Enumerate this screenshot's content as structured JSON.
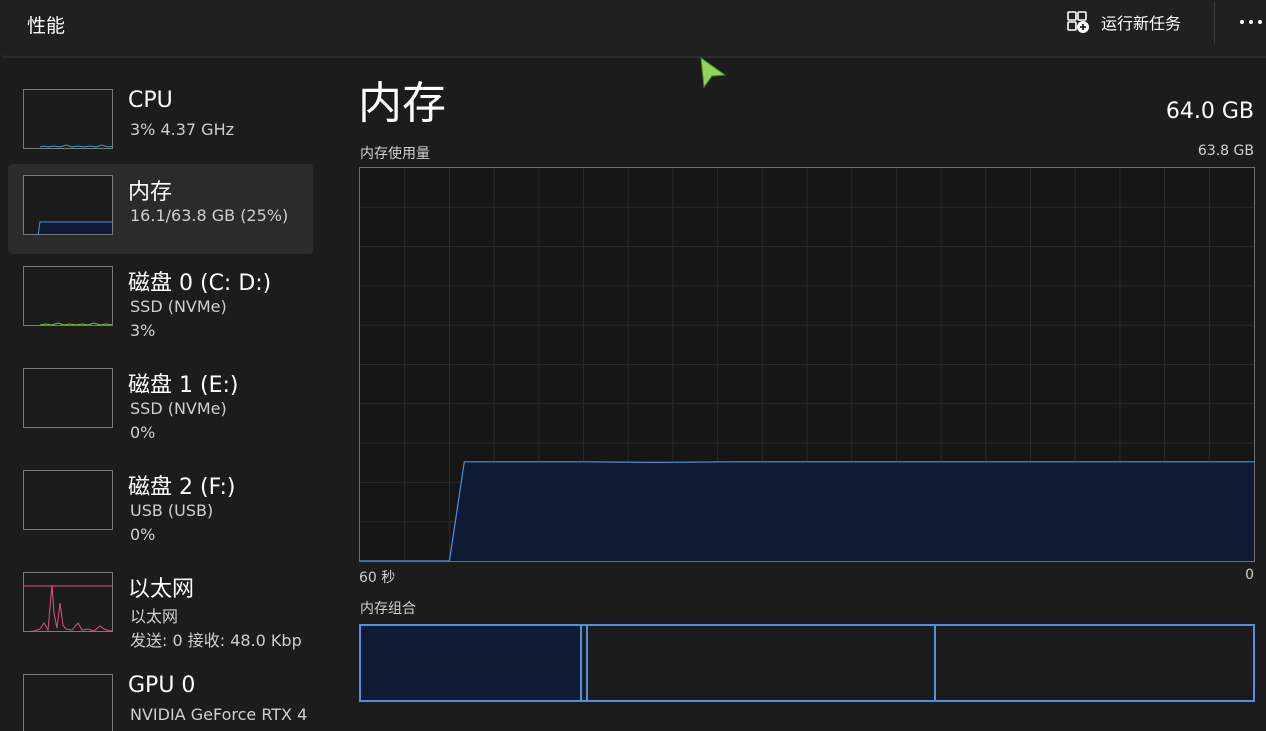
{
  "header": {
    "title": "性能",
    "run_task_label": "运行新任务",
    "more_icon": "more-icon",
    "run_task_icon": "run-task-icon"
  },
  "sidebar": {
    "items": [
      {
        "title": "CPU",
        "line1": "3%  4.37 GHz",
        "line2": "",
        "color": "#3a9bd1",
        "selected": false
      },
      {
        "title": "内存",
        "line1": "16.1/63.8 GB (25%)",
        "line2": "",
        "color": "#4f8fe6",
        "selected": true,
        "usage_fraction": 0.25
      },
      {
        "title": "磁盘 0 (C: D:)",
        "line1": "SSD (NVMe)",
        "line2": "3%",
        "color": "#7bbf3a",
        "selected": false
      },
      {
        "title": "磁盘 1 (E:)",
        "line1": "SSD (NVMe)",
        "line2": "0%",
        "color": "#7bbf3a",
        "selected": false
      },
      {
        "title": "磁盘 2 (F:)",
        "line1": "USB (USB)",
        "line2": "0%",
        "color": "#7bbf3a",
        "selected": false
      },
      {
        "title": "以太网",
        "line1": "以太网",
        "line2": "发送: 0 接收: 48.0 Kbp",
        "color": "#e0507a",
        "selected": false
      },
      {
        "title": "GPU 0",
        "line1": "NVIDIA GeForce RTX 4",
        "line2": "",
        "color": "#3a9bd1",
        "selected": false
      }
    ]
  },
  "main": {
    "title": "内存",
    "total_capacity": "64.0 GB",
    "usage_label": "内存使用量",
    "usage_max": "63.8 GB",
    "axis_left": "60 秒",
    "axis_right": "0",
    "composition_label": "内存组合"
  },
  "colors": {
    "accent": "#4f8fe6",
    "chart_fill": "#0f1a33"
  },
  "chart_data": {
    "type": "area",
    "title": "内存使用量",
    "x": [
      60,
      54,
      53,
      50,
      45,
      40,
      35,
      30,
      25,
      20,
      15,
      10,
      5,
      0
    ],
    "values": [
      0,
      0,
      16.1,
      16.1,
      16.1,
      16.0,
      16.1,
      16.1,
      16.1,
      16.1,
      16.1,
      16.1,
      16.1,
      16.1
    ],
    "xlim": [
      60,
      0
    ],
    "ylim": [
      0,
      63.8
    ],
    "x_unit": "seconds",
    "y_unit": "GB",
    "grid": true
  }
}
